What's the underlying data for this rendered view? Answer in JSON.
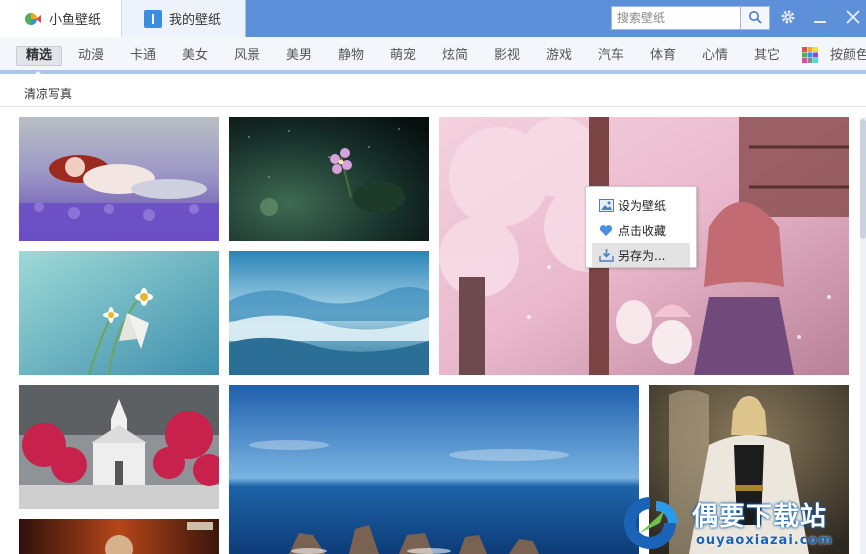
{
  "tabs": [
    {
      "label": "小鱼壁纸",
      "icon": "fish-logo-icon",
      "active": true
    },
    {
      "label": "我的壁纸",
      "icon": "bookmark-icon",
      "active": false
    }
  ],
  "search": {
    "placeholder": "搜索壁纸",
    "value": ""
  },
  "window_controls": [
    "gear-icon",
    "minimize-icon",
    "close-icon"
  ],
  "categories": [
    "精选",
    "动漫",
    "卡通",
    "美女",
    "风景",
    "美男",
    "静物",
    "萌宠",
    "炫简",
    "影视",
    "游戏",
    "汽车",
    "体育",
    "心情",
    "其它"
  ],
  "active_category": "精选",
  "color_filter_label": "按颜色",
  "subtitle": "清凉写真",
  "context_menu": {
    "items": [
      {
        "label": "设为壁纸",
        "icon": "image-icon"
      },
      {
        "label": "点击收藏",
        "icon": "heart-icon"
      },
      {
        "label": "另存为...",
        "icon": "download-icon",
        "hovered": true
      }
    ]
  },
  "thumbnails": [
    {
      "name": "girl-in-lavender",
      "colors": [
        "#b5a6c9",
        "#6f58b3"
      ]
    },
    {
      "name": "pink-flower-dark",
      "colors": [
        "#1d2e2a",
        "#0c1512"
      ]
    },
    {
      "name": "anime-fox-girl-cherry-blossom",
      "colors": [
        "#f2c9d8",
        "#a86b8e"
      ]
    },
    {
      "name": "butterfly-daisy",
      "colors": [
        "#7fc7c7",
        "#4c9bb2"
      ]
    },
    {
      "name": "misty-mountains",
      "colors": [
        "#3d8cb8",
        "#d6ecf2"
      ]
    },
    {
      "name": "church-red-trees",
      "colors": [
        "#a2a2a2",
        "#c8224a"
      ]
    },
    {
      "name": "ocean-rocks",
      "colors": [
        "#2e63a8",
        "#0e3b74"
      ]
    },
    {
      "name": "fur-coat-woman",
      "colors": [
        "#514838",
        "#c9a37c"
      ]
    },
    {
      "name": "game-poster",
      "colors": [
        "#4b1a0f",
        "#a83b19"
      ]
    }
  ],
  "watermark": {
    "title": "偶要下载站",
    "url": "ouyaoxiazai.com"
  }
}
